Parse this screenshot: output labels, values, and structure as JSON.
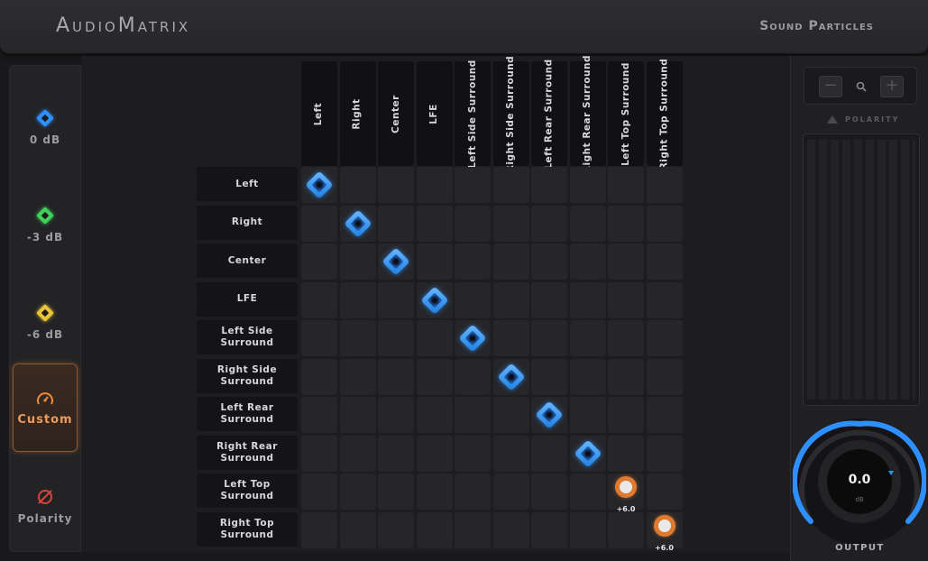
{
  "header": {
    "app_title": "AudioMatrix",
    "brand": "Sound Particles"
  },
  "sidebar": {
    "items": [
      {
        "label": "0 dB",
        "icon": "blue-diamond-icon",
        "color": "#2e8fff"
      },
      {
        "label": "-3 dB",
        "icon": "green-diamond-icon",
        "color": "#3fcf5a"
      },
      {
        "label": "-6 dB",
        "icon": "yellow-diamond-icon",
        "color": "#e8c43a"
      },
      {
        "label": "Custom",
        "icon": "gauge-icon",
        "color": "#ee8a3c",
        "active": true
      },
      {
        "label": "Polarity",
        "icon": "polarity-icon",
        "color": "#d8443a"
      }
    ]
  },
  "matrix": {
    "columns": [
      "Left",
      "Right",
      "Center",
      "LFE",
      "Left Side Surround",
      "Right Side Surround",
      "Left Rear Surround",
      "Right Rear Surround",
      "Left Top Surround",
      "Right Top Surround"
    ],
    "rows": [
      "Left",
      "Right",
      "Center",
      "LFE",
      "Left Side Surround",
      "Right Side Surround",
      "Left Rear Surround",
      "Right Rear Surround",
      "Left Top Surround",
      "Right Top Surround"
    ],
    "routing": [
      {
        "row": 0,
        "col": 0,
        "kind": "gain",
        "color": "#2e8fff"
      },
      {
        "row": 1,
        "col": 1,
        "kind": "gain",
        "color": "#2e8fff"
      },
      {
        "row": 2,
        "col": 2,
        "kind": "gain",
        "color": "#2e8fff"
      },
      {
        "row": 3,
        "col": 3,
        "kind": "gain",
        "color": "#2e8fff"
      },
      {
        "row": 4,
        "col": 4,
        "kind": "gain",
        "color": "#2e8fff"
      },
      {
        "row": 5,
        "col": 5,
        "kind": "gain",
        "color": "#2e8fff"
      },
      {
        "row": 6,
        "col": 6,
        "kind": "gain",
        "color": "#2e8fff"
      },
      {
        "row": 7,
        "col": 7,
        "kind": "gain",
        "color": "#2e8fff"
      },
      {
        "row": 8,
        "col": 8,
        "kind": "custom",
        "value": "+6.0",
        "color": "#e07a2e"
      },
      {
        "row": 9,
        "col": 9,
        "kind": "custom",
        "value": "+6.0",
        "color": "#e07a2e"
      }
    ]
  },
  "right_panel": {
    "zoom_out": "−",
    "zoom_in": "+",
    "polarity_label": "POLARITY",
    "output_value": "0.0",
    "output_unit": "dB",
    "output_label": "OUTPUT",
    "accent": "#2e8fff"
  }
}
